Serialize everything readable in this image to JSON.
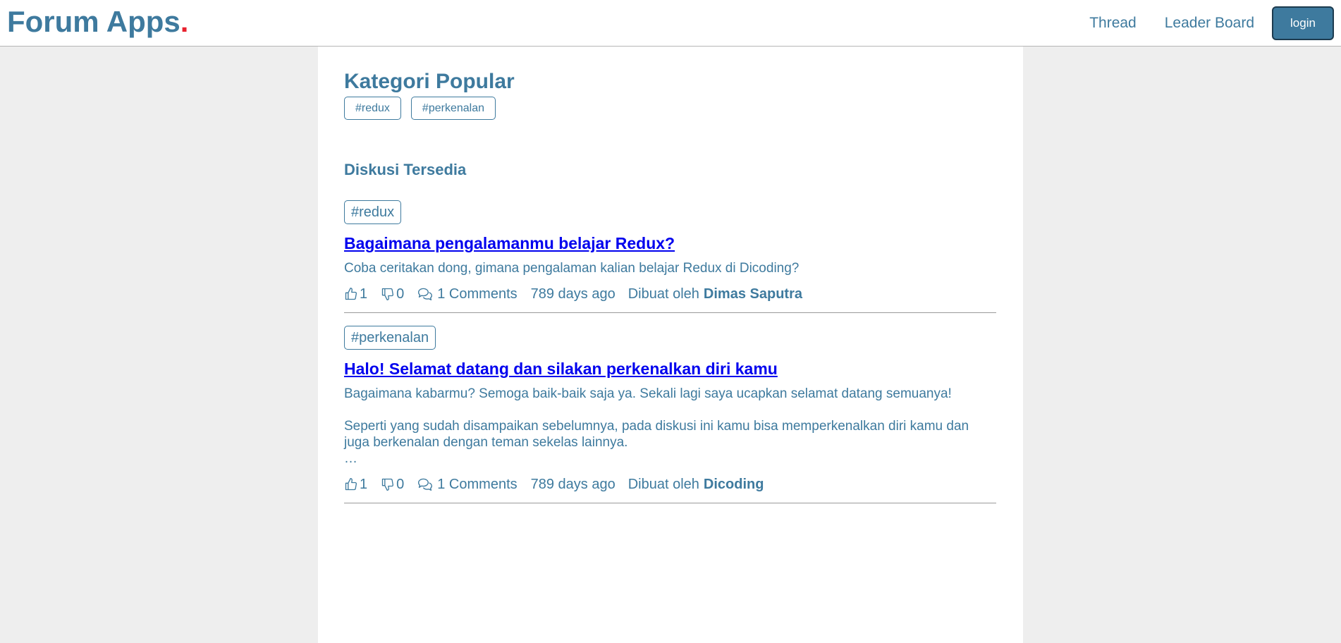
{
  "header": {
    "brand": "Forum Apps",
    "brand_dot": ".",
    "nav": {
      "thread": "Thread",
      "leaderboard": "Leader Board",
      "login": "login"
    }
  },
  "categories": {
    "title": "Kategori Popular",
    "items": [
      "#redux",
      "#perkenalan"
    ]
  },
  "threads_title": "Diskusi Tersedia",
  "threads": [
    {
      "category": "#redux",
      "title": "Bagaimana pengalamanmu belajar Redux?",
      "body": [
        "Coba ceritakan dong, gimana pengalaman kalian belajar Redux di Dicoding?"
      ],
      "likes": "1",
      "dislikes": "0",
      "comments": "1 Comments",
      "time": "789 days ago",
      "created_by_label": "Dibuat oleh",
      "author": "Dimas Saputra"
    },
    {
      "category": "#perkenalan",
      "title": "Halo! Selamat datang dan silakan perkenalkan diri kamu",
      "body": [
        "Bagaimana kabarmu? Semoga baik-baik saja ya. Sekali lagi saya ucapkan selamat datang semuanya!",
        "Seperti yang sudah disampaikan sebelumnya, pada diskusi ini kamu bisa memperkenalkan diri kamu dan juga berkenalan dengan teman sekelas lainnya.",
        "…"
      ],
      "likes": "1",
      "dislikes": "0",
      "comments": "1 Comments",
      "time": "789 days ago",
      "created_by_label": "Dibuat oleh",
      "author": "Dicoding"
    }
  ],
  "icons": {
    "like": "thumbs-up-icon",
    "dislike": "thumbs-down-icon",
    "comment": "comments-icon"
  },
  "colors": {
    "accent": "#3e7a9e",
    "brand_dot": "#e8212e",
    "link": "#0000ee",
    "background": "#eeeeee"
  }
}
